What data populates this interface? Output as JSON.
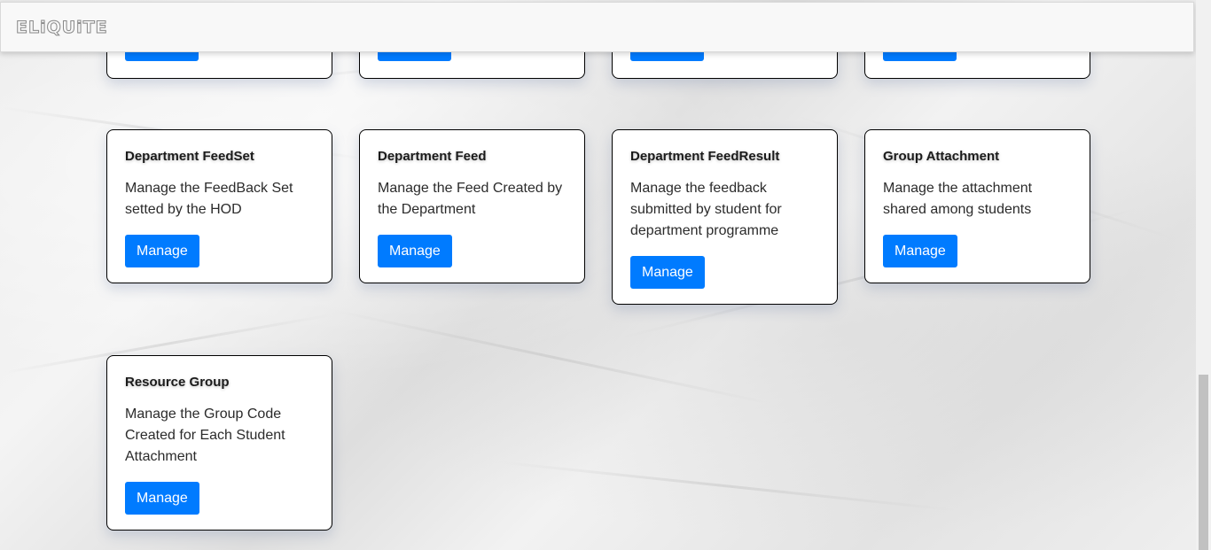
{
  "navbar": {
    "brand": "ELiQUiTE"
  },
  "cards": [
    {
      "title": "Department FeedSet",
      "description": "Manage the FeedBack Set setted by the HOD",
      "button": "Manage"
    },
    {
      "title": "Department Feed",
      "description": "Manage the Feed Created by the Department",
      "button": "Manage"
    },
    {
      "title": "Department FeedResult",
      "description": "Manage the feedback submitted by student for department programme",
      "button": "Manage"
    },
    {
      "title": "Group Attachment",
      "description": "Manage the attachment shared among students",
      "button": "Manage"
    },
    {
      "title": "Resource Group",
      "description": "Manage the Group Code Created for Each Student Attachment",
      "button": "Manage"
    }
  ],
  "colors": {
    "primary_button": "#007bff",
    "card_border": "#000000",
    "navbar_bg": "#f8f8f8"
  }
}
